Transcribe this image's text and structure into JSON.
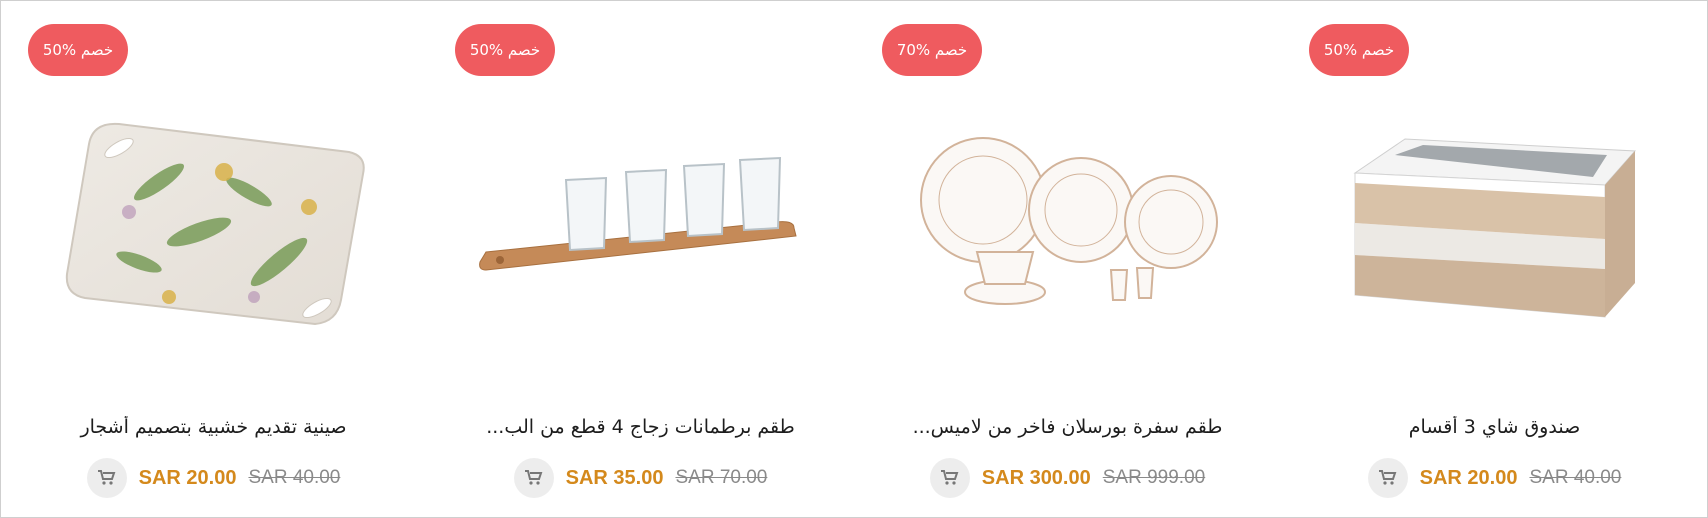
{
  "products": [
    {
      "badge": "50% خصم",
      "title": "صينية تقديم خشبية بتصميم أشجار",
      "price": "SAR 20.00",
      "old_price": "SAR 40.00",
      "image_icon": "floral-serving-tray-icon"
    },
    {
      "badge": "50% خصم",
      "title": "طقم برطمانات زجاج 4 قطع من الب...",
      "price": "SAR 35.00",
      "old_price": "SAR 70.00",
      "image_icon": "glass-set-on-wooden-board-icon"
    },
    {
      "badge": "70% خصم",
      "title": "طقم سفرة بورسلان فاخر من لاميس...",
      "price": "SAR 300.00",
      "old_price": "SAR 999.00",
      "image_icon": "porcelain-dinner-set-icon"
    },
    {
      "badge": "50% خصم",
      "title": "صندوق شاي 3 أقسام",
      "price": "SAR 20.00",
      "old_price": "SAR 40.00",
      "image_icon": "tea-box-icon"
    }
  ],
  "colors": {
    "badge": "#ef5b5f",
    "price": "#d4891c",
    "old_price": "#8a8a8a",
    "cart_bg": "#ededed"
  },
  "cart_icon": "shopping-cart-icon"
}
